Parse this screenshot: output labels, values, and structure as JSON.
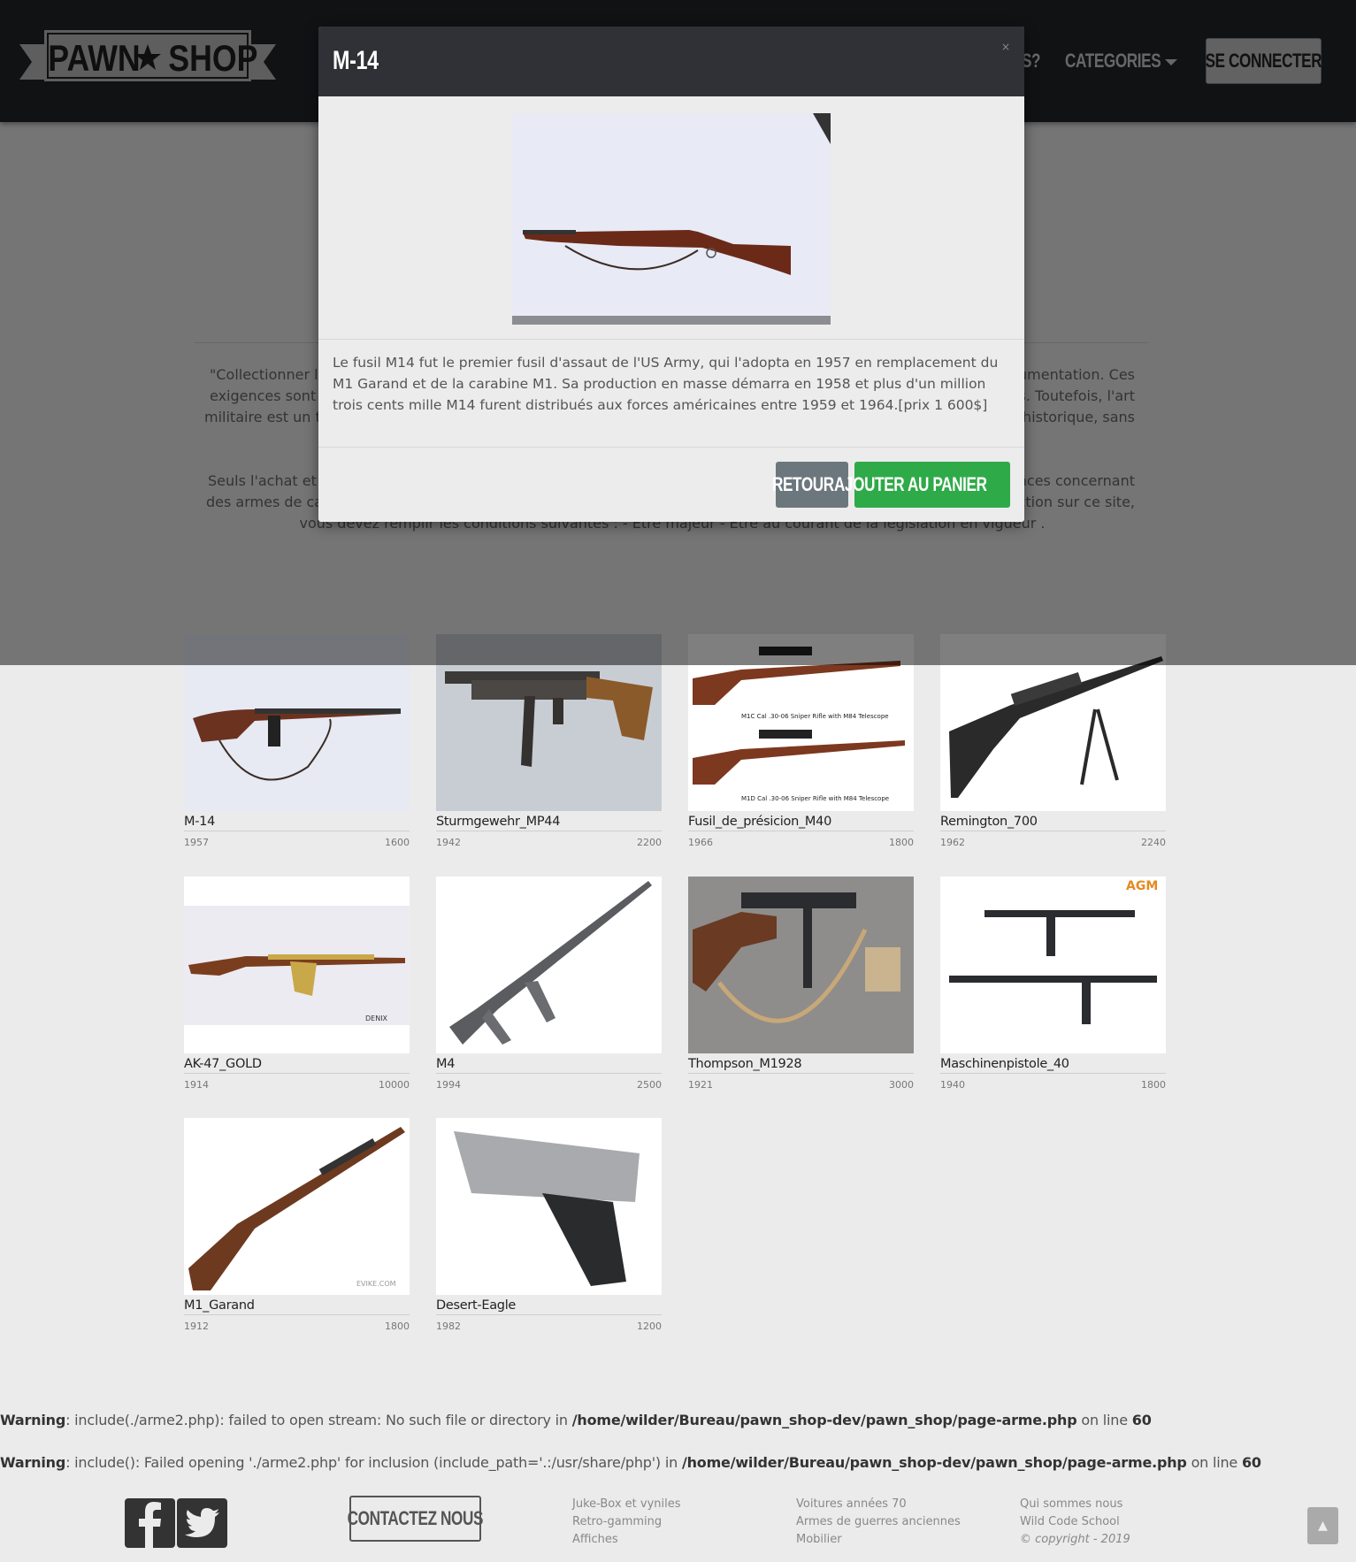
{
  "navbar": {
    "logo_text_left": "PAWN",
    "logo_text_right": "SHOP",
    "partial_link": "S?",
    "categories_label": "CATEGORIES",
    "login_label": "SE CONNECTER"
  },
  "intro": {
    "line1_left": "\"Collectionner le",
    "line1_right": "umentation. Ces",
    "line2_left": "exigences sont c",
    "line2_right": "es. Toutefois, l'art",
    "line3_left": "militaire est un th",
    "line3_right": "x historique, sans",
    "line4_left": "Seuls l'achat et la",
    "line4_right": "nces concernant",
    "line5_left": "des armes de cat",
    "line5_right": "ection sur ce site,",
    "line6": "vous devez remplir les conditions suivantes : - Etre majeur - Etre au courant de la législation en vigueur ."
  },
  "products": [
    {
      "name": "M-14",
      "year": "1957",
      "price": "1600"
    },
    {
      "name": "Sturmgewehr_MP44",
      "year": "1942",
      "price": "2200"
    },
    {
      "name": "Fusil_de_présicion_M40",
      "year": "1966",
      "price": "1800"
    },
    {
      "name": "Remington_700",
      "year": "1962",
      "price": "2240"
    },
    {
      "name": "AK-47_GOLD",
      "year": "1914",
      "price": "10000"
    },
    {
      "name": "M4",
      "year": "1994",
      "price": "2500"
    },
    {
      "name": "Thompson_M1928",
      "year": "1921",
      "price": "3000"
    },
    {
      "name": "Maschinenpistole_40",
      "year": "1940",
      "price": "1800"
    },
    {
      "name": "M1_Garand",
      "year": "1912",
      "price": "1800"
    },
    {
      "name": "Desert-Eagle",
      "year": "1982",
      "price": "1200"
    }
  ],
  "image_labels": {
    "m40_top": "M1C Cal .30-06 Sniper Rifle with M84 Telescope",
    "m40_bottom": "M1D Cal .30-06 Sniper Rifle with M84 Telescope",
    "ak_brand": "DENIX",
    "mp40_brand": "AGM",
    "garand_brand": "EVIKE.COM"
  },
  "modal": {
    "title": "M-14",
    "close": "×",
    "description": "Le fusil M14 fut le premier fusil d'assaut de l'US Army, qui l'adopta en 1957 en remplacement du M1 Garand et de la carabine M1. Sa production en masse démarra en 1958 et plus d'un million trois cents mille M14 furent distribués aux forces américaines entre 1959 et 1964.[prix 1 600$]",
    "back_label": "RETOUR",
    "add_cart_label": "AJOUTER AU PANIER"
  },
  "warnings": [
    {
      "label": "Warning",
      "msg": ": include(./arme2.php): failed to open stream: No such file or directory in ",
      "path": "/home/wilder/Bureau/pawn_shop-dev/pawn_shop/page-arme.php",
      "mid": " on line ",
      "line": "60"
    },
    {
      "label": "Warning",
      "msg": ": include(): Failed opening './arme2.php' for inclusion (include_path='.:/usr/share/php') in ",
      "path": "/home/wilder/Bureau/pawn_shop-dev/pawn_shop/page-arme.php",
      "mid": " on line ",
      "line": "60"
    }
  ],
  "footer": {
    "contact_label": "CONTACTEZ NOUS",
    "col1": [
      "Juke-Box et vyniles",
      "Retro-gamming",
      "Affiches"
    ],
    "col2": [
      "Voitures années 70",
      "Armes de guerres anciennes",
      "Mobilier"
    ],
    "col3": [
      "Qui sommes nous",
      "Wild Code School",
      "© copyright - 2019"
    ],
    "to_top": "▲"
  },
  "colors": {
    "navbar_bg": "#222428",
    "modal_header_bg": "#2f3136",
    "btn_back": "#6c767d",
    "btn_cart": "#2faa48",
    "page_bg": "#ebebeb"
  },
  "icons": [
    "facebook-icon",
    "twitter-icon",
    "star-icon",
    "caret-down-icon",
    "arrow-up-icon"
  ]
}
